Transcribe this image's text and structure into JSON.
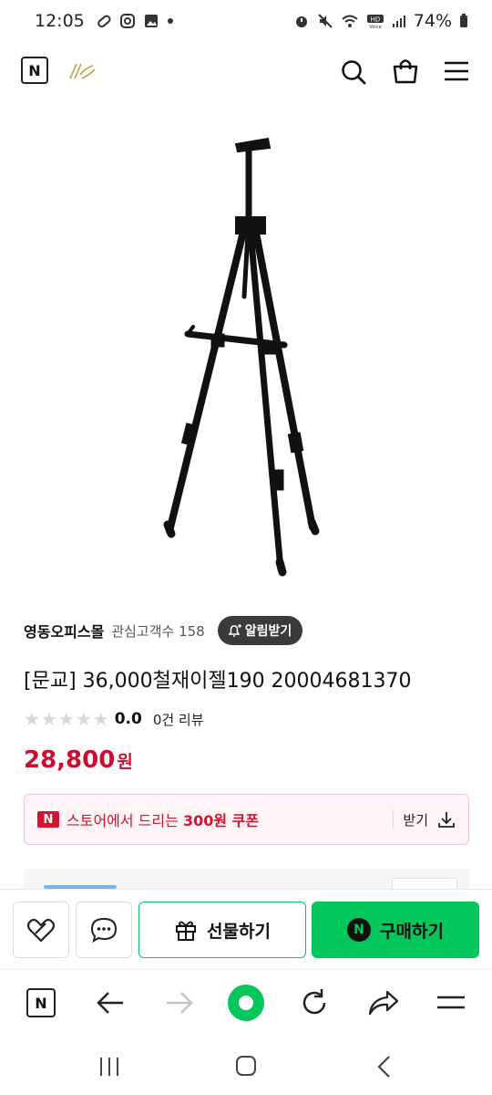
{
  "status_bar": {
    "time": "12:05",
    "battery": "74%"
  },
  "header": {
    "logo": "N",
    "icons": [
      "search-icon",
      "cart-icon",
      "menu-icon"
    ]
  },
  "store": {
    "name": "영동오피스몰",
    "favorite_label": "관심고객수 158",
    "alarm_label": "알림받기"
  },
  "product": {
    "title": "[문교] 36,000철재이젤190 20004681370",
    "rating": "0.0",
    "review_label": "0건 리뷰",
    "price": "28,800",
    "price_unit": "원"
  },
  "coupon": {
    "badge": "N",
    "text_prefix": "스토어에서 드리는 ",
    "text_bold": "300원 쿠폰",
    "get_label": "받기"
  },
  "action_bar": {
    "gift_label": "선물하기",
    "buy_label": "구매하기",
    "buy_badge": "N"
  },
  "browser_bar": {
    "logo": "N"
  },
  "colors": {
    "brand_green": "#03c75a",
    "price_red": "#c8102e"
  }
}
